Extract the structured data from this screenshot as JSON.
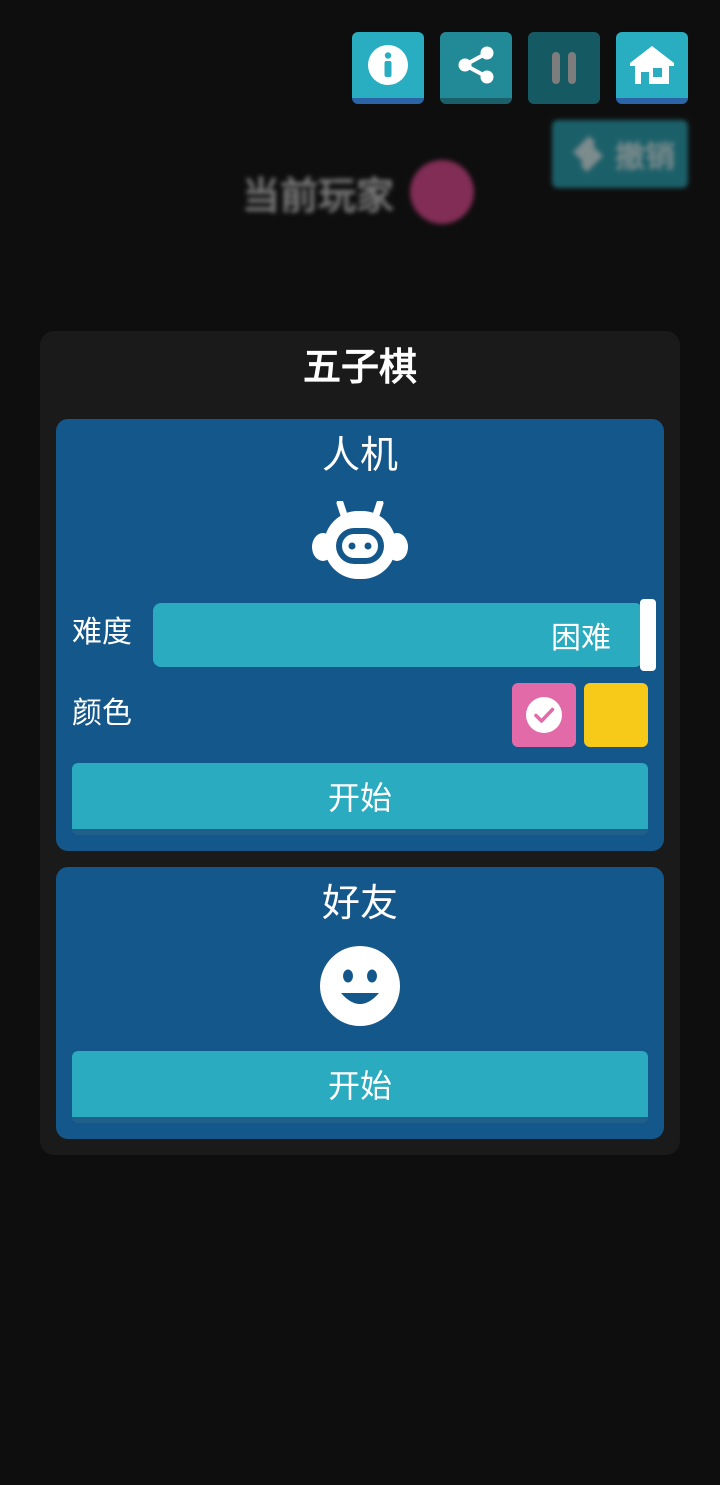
{
  "toolbar": {
    "buttons": [
      {
        "icon": "info-icon"
      },
      {
        "icon": "share-icon"
      },
      {
        "icon": "pause-icon"
      },
      {
        "icon": "home-icon"
      }
    ]
  },
  "background": {
    "undo_label": "撤销",
    "current_player_label": "当前玩家",
    "current_player_color": "#e0478f"
  },
  "panel": {
    "title": "五子棋",
    "ai_card": {
      "title": "人机",
      "icon": "robot-icon",
      "difficulty_label": "难度",
      "difficulty_value": "困难",
      "color_label": "颜色",
      "colors": [
        {
          "hex": "#e36aa8",
          "selected": true
        },
        {
          "hex": "#f7c919",
          "selected": false
        }
      ],
      "start_label": "开始"
    },
    "friend_card": {
      "title": "好友",
      "icon": "smiley-icon",
      "start_label": "开始"
    }
  }
}
